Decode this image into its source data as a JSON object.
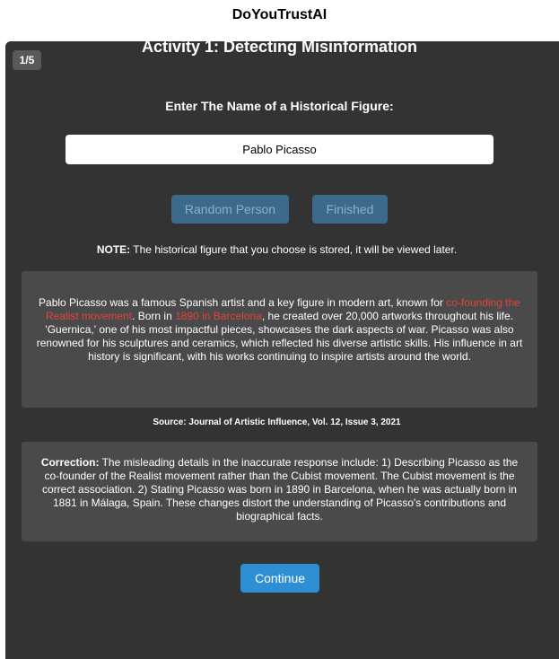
{
  "app": {
    "title": "DoYouTrustAI"
  },
  "activity": {
    "step_badge": "1/5",
    "title": "Activity 1: Detecting Misinformation",
    "prompt_label": "Enter The Name of a Historical Figure:",
    "name_input_value": "Pablo Picasso",
    "buttons": {
      "random_label": "Random Person",
      "finished_label": "Finished",
      "continue_label": "Continue"
    },
    "note": {
      "label": "NOTE:",
      "text": " The historical figure that you choose is stored, it will be viewed later."
    },
    "response": {
      "p1": "Pablo Picasso was a famous Spanish artist and a key figure in modern art, known for ",
      "h1": "co-founding the Realist movement",
      "p2": ". Born in ",
      "h2": "1890 in Barcelona",
      "p3": ", he created over 20,000 artworks throughout his life. 'Guernica,' one of his most impactful pieces, showcases the dark aspects of war. Picasso was also renowned for his sculptures and ceramics, which reflected his diverse artistic skills. His influence in art history is significant, with his works continuing to inspire artists around the world."
    },
    "source": "Source: Journal of Artistic Influence, Vol. 12, Issue 3, 2021",
    "correction": {
      "label": "Correction:",
      "text": " The misleading details in the inaccurate response include: 1) Describing Picasso as the co-founder of the Realist movement rather than the Cubist movement. The Cubist movement is the correct association. 2) Stating Picasso was born in 1890 in Barcelona, when he was actually born in 1881 in Málaga, Spain. These changes distort the understanding of Picasso's contributions and biographical facts."
    }
  },
  "colors": {
    "panel_bg": "#333333",
    "box_bg": "#4a4a4a",
    "highlight": "#e0443a",
    "primary_button": "#2f8fd4",
    "disabled_button": "#3c6a8a"
  }
}
